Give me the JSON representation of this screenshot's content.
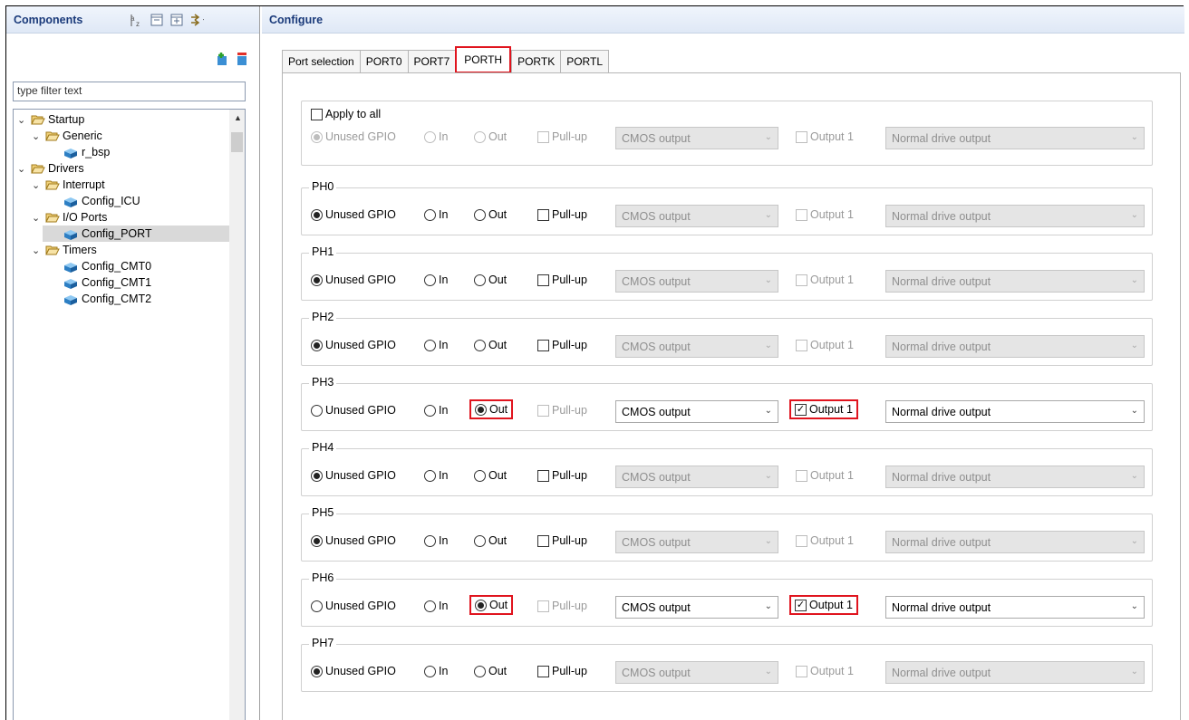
{
  "components": {
    "title": "Components",
    "filter_placeholder": "type filter text",
    "tree": [
      {
        "label": "Startup"
      },
      {
        "label": "Generic"
      },
      {
        "label": "r_bsp"
      },
      {
        "label": "Drivers"
      },
      {
        "label": "Interrupt"
      },
      {
        "label": "Config_ICU"
      },
      {
        "label": "I/O Ports"
      },
      {
        "label": "Config_PORT"
      },
      {
        "label": "Timers"
      },
      {
        "label": "Config_CMT0"
      },
      {
        "label": "Config_CMT1"
      },
      {
        "label": "Config_CMT2"
      }
    ]
  },
  "configure": {
    "title": "Configure",
    "tabs": [
      "Port selection",
      "PORT0",
      "PORT7",
      "PORTH",
      "PORTK",
      "PORTL"
    ],
    "active_tab": "PORTH",
    "apply_all": "Apply to all",
    "labels": {
      "unused": "Unused GPIO",
      "in": "In",
      "out": "Out",
      "pullup": "Pull-up",
      "output_mode": "CMOS output",
      "output1": "Output 1",
      "drive": "Normal drive output"
    },
    "pins": [
      {
        "name": "PH0",
        "mode": "Unused GPIO",
        "output1": false
      },
      {
        "name": "PH1",
        "mode": "Unused GPIO",
        "output1": false
      },
      {
        "name": "PH2",
        "mode": "Unused GPIO",
        "output1": false
      },
      {
        "name": "PH3",
        "mode": "Out",
        "output1": true
      },
      {
        "name": "PH4",
        "mode": "Unused GPIO",
        "output1": false
      },
      {
        "name": "PH5",
        "mode": "Unused GPIO",
        "output1": false
      },
      {
        "name": "PH6",
        "mode": "Out",
        "output1": true
      },
      {
        "name": "PH7",
        "mode": "Unused GPIO",
        "output1": false
      }
    ]
  },
  "colors": {
    "highlight": "#e0141e",
    "header_text": "#1a3a7a"
  }
}
